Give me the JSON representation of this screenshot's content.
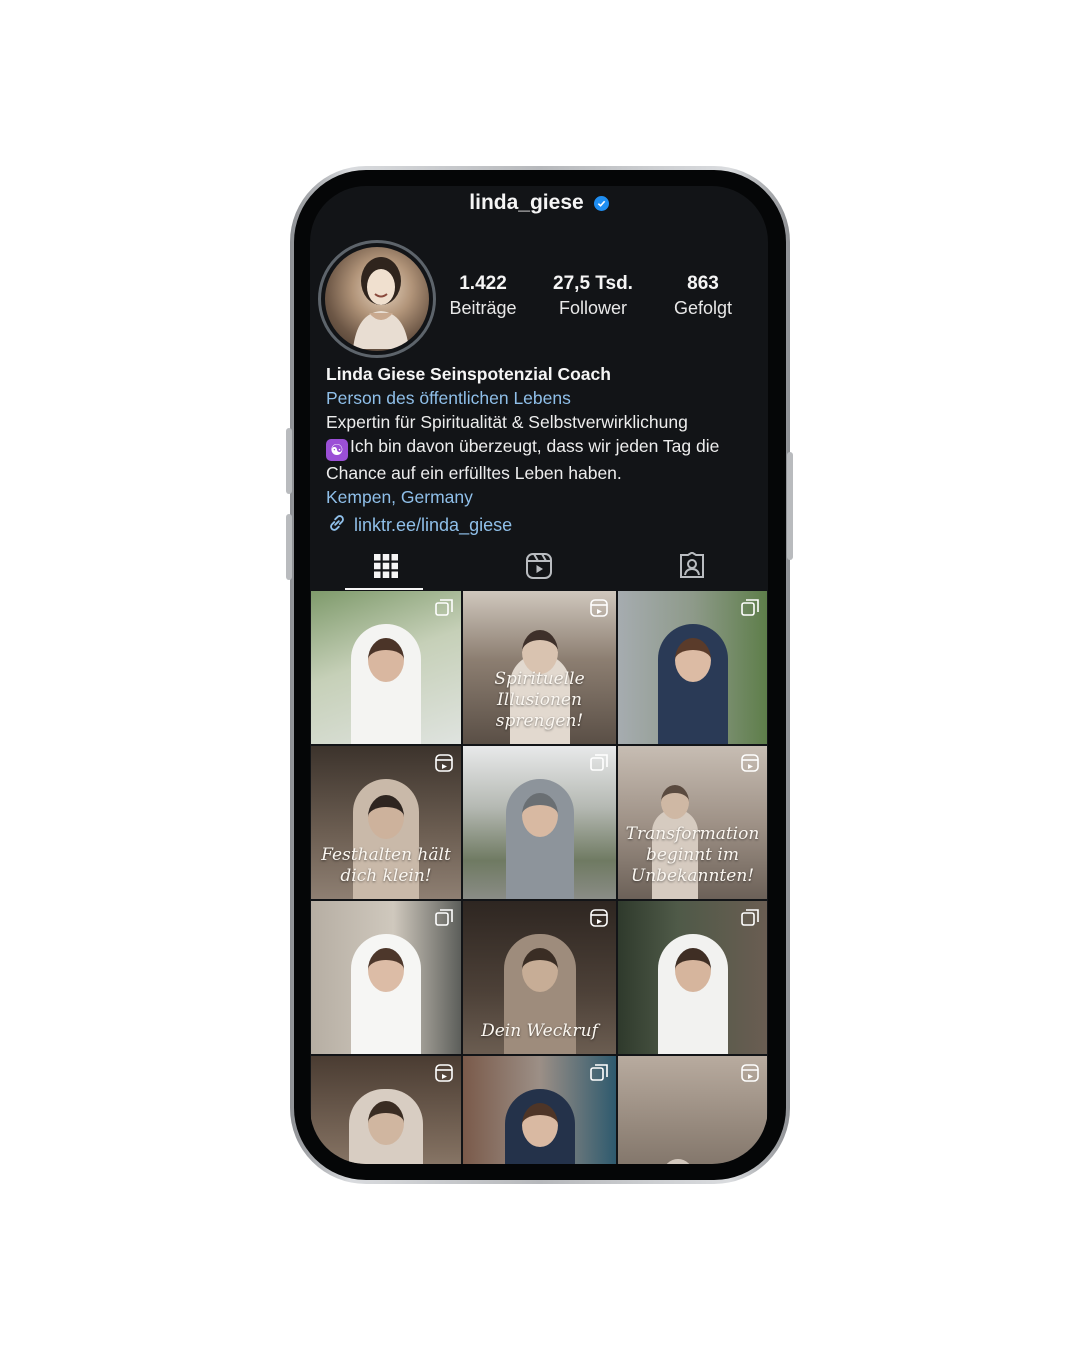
{
  "profile": {
    "username": "linda_giese",
    "verified": true,
    "stats": {
      "posts_value": "1.422",
      "posts_label": "Beiträge",
      "followers_value": "27,5 Tsd.",
      "followers_label": "Follower",
      "following_value": "863",
      "following_label": "Gefolgt"
    },
    "bio": {
      "name": "Linda Giese Seinspotenzial Coach",
      "category": "Person des öffentlichen Lebens",
      "line1": "Expertin für Spiritualität & Selbstverwirklichung",
      "line2": "Ich bin davon überzeugt, dass wir jeden Tag die Chance auf ein erfülltes Leben haben.",
      "location": "Kempen, Germany",
      "link": "linktr.ee/linda_giese"
    }
  },
  "tabs": [
    {
      "icon": "grid-icon",
      "active": true
    },
    {
      "icon": "reels-icon",
      "active": false
    },
    {
      "icon": "tagged-icon",
      "active": false
    }
  ],
  "posts": [
    {
      "caption": "",
      "badge": "multi"
    },
    {
      "caption": "Spirituelle Illusionen sprengen!",
      "badge": "reel"
    },
    {
      "caption": "",
      "badge": "multi"
    },
    {
      "caption": "Festhalten hält dich klein!",
      "badge": "reel"
    },
    {
      "caption": "",
      "badge": "multi"
    },
    {
      "caption": "Transformation beginnt im Unbekannten!",
      "badge": "reel"
    },
    {
      "caption": "",
      "badge": "multi"
    },
    {
      "caption": "Dein Weckruf",
      "badge": "reel"
    },
    {
      "caption": "",
      "badge": "multi"
    },
    {
      "caption": "",
      "badge": "reel"
    },
    {
      "caption": "",
      "badge": "multi"
    },
    {
      "caption": "",
      "badge": "reel"
    }
  ],
  "colors": {
    "screen_bg": "#121417",
    "link_blue": "#8fbfe9",
    "verified_blue": "#1f8ef1"
  }
}
